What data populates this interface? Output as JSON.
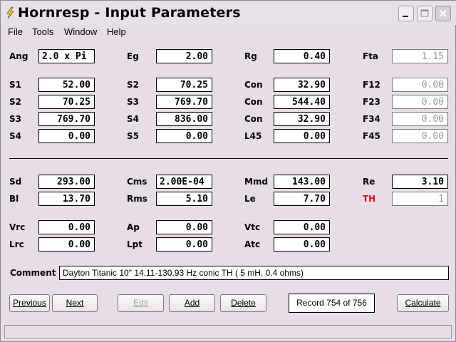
{
  "window": {
    "title": "Hornresp - Input Parameters"
  },
  "menu": [
    "File",
    "Tools",
    "Window",
    "Help"
  ],
  "fields": [
    {
      "label": "Ang",
      "value": "2.0 x Pi",
      "align": "left"
    },
    {
      "label": "Eg",
      "value": "2.00"
    },
    {
      "label": "Rg",
      "value": "0.40"
    },
    {
      "label": "Fta",
      "value": "1.15",
      "readonly": true
    },
    {
      "label": "S1",
      "value": "52.00"
    },
    {
      "label": "S2",
      "value": "70.25"
    },
    {
      "label": "Con",
      "value": "32.90"
    },
    {
      "label": "F12",
      "value": "0.00",
      "readonly": true
    },
    {
      "label": "S2",
      "value": "70.25"
    },
    {
      "label": "S3",
      "value": "769.70"
    },
    {
      "label": "Con",
      "value": "544.40"
    },
    {
      "label": "F23",
      "value": "0.00",
      "readonly": true
    },
    {
      "label": "S3",
      "value": "769.70"
    },
    {
      "label": "S4",
      "value": "836.00"
    },
    {
      "label": "Con",
      "value": "32.90"
    },
    {
      "label": "F34",
      "value": "0.00",
      "readonly": true
    },
    {
      "label": "S4",
      "value": "0.00"
    },
    {
      "label": "S5",
      "value": "0.00"
    },
    {
      "label": "L45",
      "value": "0.00"
    },
    {
      "label": "F45",
      "value": "0.00",
      "readonly": true
    },
    {
      "label": "Sd",
      "value": "293.00"
    },
    {
      "label": "Cms",
      "value": "2.00E-04",
      "align": "left"
    },
    {
      "label": "Mmd",
      "value": "143.00"
    },
    {
      "label": "Re",
      "value": "3.10"
    },
    {
      "label": "Bl",
      "value": "13.70"
    },
    {
      "label": "Rms",
      "value": "5.10"
    },
    {
      "label": "Le",
      "value": "7.70"
    },
    {
      "label": "TH",
      "value": "1",
      "readonly": true,
      "label_color": "#e01010"
    },
    {
      "label": "Vrc",
      "value": "0.00"
    },
    {
      "label": "Ap",
      "value": "0.00"
    },
    {
      "label": "Vtc",
      "value": "0.00"
    },
    {
      "label": "Lrc",
      "value": "0.00"
    },
    {
      "label": "Lpt",
      "value": "0.00"
    },
    {
      "label": "Atc",
      "value": "0.00"
    }
  ],
  "comment": {
    "label": "Comment",
    "value": "Dayton Titanic 10\" 14.11-130.93 Hz conic TH ( 5 mH, 0.4 ohms)"
  },
  "buttons": {
    "previous": "Previous",
    "next": "Next",
    "edit": "Edit",
    "add": "Add",
    "delete": "Delete",
    "calculate": "Calculate"
  },
  "record": "Record 754 of 756"
}
